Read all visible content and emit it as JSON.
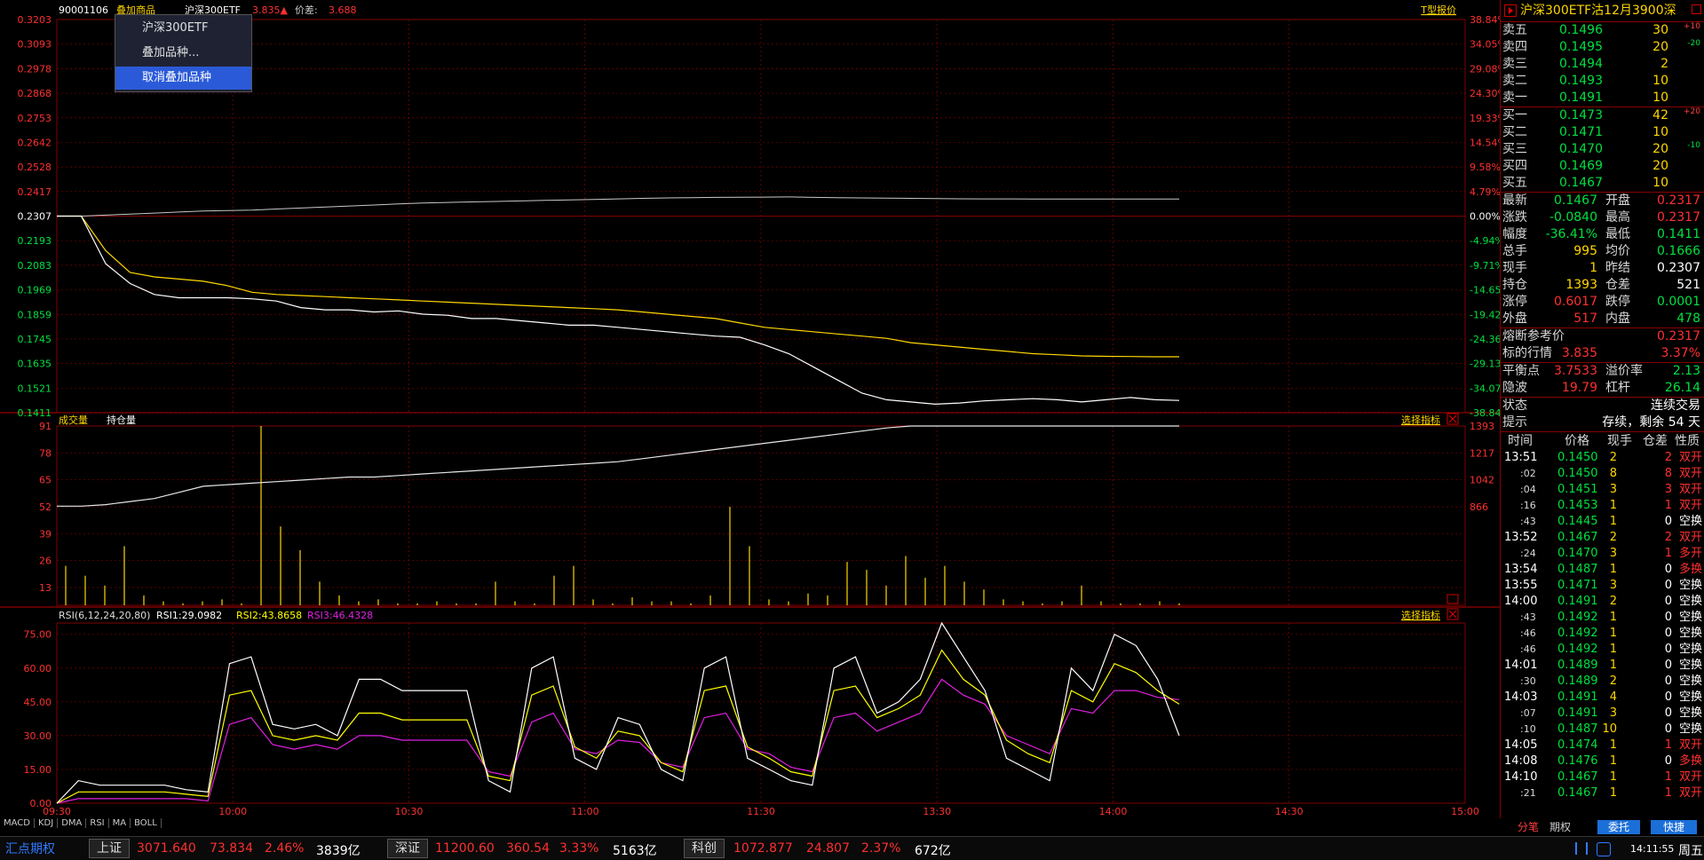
{
  "header": {
    "code": "90001106",
    "overlay_menu": "叠加商品",
    "overlay_name": "沪深300ETF",
    "overlay_price": "3.835▲",
    "spread_label": "价差:",
    "spread_value": "3.688",
    "t_quote": "T型报价"
  },
  "overlay_dropdown": {
    "items": [
      "沪深300ETF",
      "叠加品种...",
      "取消叠加品种"
    ]
  },
  "price_axis": {
    "left": [
      "0.3203",
      "0.3093",
      "0.2978",
      "0.2868",
      "0.2753",
      "0.2642",
      "0.2528",
      "0.2417",
      "0.2307",
      "0.2193",
      "0.2083",
      "0.1969",
      "0.1859",
      "0.1745",
      "0.1635",
      "0.1521",
      "0.1411"
    ],
    "right": [
      "38.84%",
      "34.05%",
      "29.08%",
      "24.30%",
      "19.33%",
      "14.54%",
      "9.58%",
      "4.79%",
      "0.00%",
      "-4.94%",
      "-9.71%",
      "-14.65%",
      "-19.42%",
      "-24.36%",
      "-29.13%",
      "-34.07%",
      "-38.84%"
    ]
  },
  "volume_panel": {
    "tab_volume": "成交量",
    "tab_oi": "持仓量",
    "select_indicator": "选择指标",
    "left_axis": [
      "91",
      "78",
      "65",
      "52",
      "39",
      "26",
      "13"
    ],
    "right_axis": [
      "1393",
      "1217",
      "1042",
      "866"
    ]
  },
  "rsi_panel": {
    "title": "RSI(6,12,24,20,80)",
    "rsi1": "RSI1:29.0982",
    "rsi2": "RSI2:43.8658",
    "rsi3": "RSI3:46.4328",
    "select_indicator": "选择指标",
    "axis": [
      "75.00",
      "60.00",
      "45.00",
      "30.00",
      "15.00",
      "0.00"
    ]
  },
  "time_axis": [
    "09:30",
    "10:00",
    "10:30",
    "11:00",
    "11:30",
    "13:30",
    "14:00",
    "14:30",
    "15:00"
  ],
  "indicator_tabs": [
    "MACD",
    "KDJ",
    "DMA",
    "RSI",
    "MA",
    "BOLL"
  ],
  "panel": {
    "title": "沪深300ETF沽12月3900深",
    "asks": [
      {
        "label": "卖五",
        "price": "0.1496",
        "vol": "30",
        "chg": "+10"
      },
      {
        "label": "卖四",
        "price": "0.1495",
        "vol": "20",
        "chg": "-20"
      },
      {
        "label": "卖三",
        "price": "0.1494",
        "vol": "2",
        "chg": ""
      },
      {
        "label": "卖二",
        "price": "0.1493",
        "vol": "10",
        "chg": ""
      },
      {
        "label": "卖一",
        "price": "0.1491",
        "vol": "10",
        "chg": ""
      }
    ],
    "bids": [
      {
        "label": "买一",
        "price": "0.1473",
        "vol": "42",
        "chg": "+20"
      },
      {
        "label": "买二",
        "price": "0.1471",
        "vol": "10",
        "chg": ""
      },
      {
        "label": "买三",
        "price": "0.1470",
        "vol": "20",
        "chg": "-10"
      },
      {
        "label": "买四",
        "price": "0.1469",
        "vol": "20",
        "chg": ""
      },
      {
        "label": "买五",
        "price": "0.1467",
        "vol": "10",
        "chg": ""
      }
    ],
    "quotes": [
      {
        "l1": "最新",
        "v1": "0.1467",
        "c1": "grn",
        "l2": "开盘",
        "v2": "0.2317",
        "c2": "red"
      },
      {
        "l1": "涨跌",
        "v1": "-0.0840",
        "c1": "grn",
        "l2": "最高",
        "v2": "0.2317",
        "c2": "red"
      },
      {
        "l1": "幅度",
        "v1": "-36.41%",
        "c1": "grn",
        "l2": "最低",
        "v2": "0.1411",
        "c2": "grn"
      },
      {
        "l1": "总手",
        "v1": "995",
        "c1": "yel",
        "l2": "均价",
        "v2": "0.1666",
        "c2": "grn"
      },
      {
        "l1": "现手",
        "v1": "1",
        "c1": "yel",
        "l2": "昨结",
        "v2": "0.2307",
        "c2": "wht"
      },
      {
        "l1": "持仓",
        "v1": "1393",
        "c1": "yel",
        "l2": "仓差",
        "v2": "521",
        "c2": "wht"
      },
      {
        "l1": "涨停",
        "v1": "0.6017",
        "c1": "red",
        "l2": "跌停",
        "v2": "0.0001",
        "c2": "grn"
      },
      {
        "l1": "外盘",
        "v1": "517",
        "c1": "red",
        "l2": "内盘",
        "v2": "478",
        "c2": "grn"
      }
    ],
    "fuse_label": "熔断参考价",
    "fuse_value": "0.2317",
    "underlying_label": "标的行情",
    "underlying_price": "3.835",
    "underlying_pct": "3.37%",
    "balance_label": "平衡点",
    "balance_value": "3.7533",
    "premium_label": "溢价率",
    "premium_value": "2.13",
    "iv_label": "隐波",
    "iv_value": "19.79",
    "leverage_label": "杠杆",
    "leverage_value": "26.14",
    "state_label": "状态",
    "state_value": "连续交易",
    "hint_label": "提示",
    "hint_value": "存续，剩余",
    "hint_days": "54",
    "hint_unit": "天",
    "tick_headers": [
      "时间",
      "价格",
      "现手",
      "仓差",
      "性质"
    ],
    "ticks": [
      {
        "t": "13:51",
        "p": "0.1450",
        "v": "2",
        "c": "2",
        "n": "双开",
        "pc": "grn",
        "cc": "red",
        "nc": "red"
      },
      {
        "t": ":02",
        "p": "0.1450",
        "v": "8",
        "c": "8",
        "n": "双开",
        "pc": "grn",
        "cc": "red",
        "nc": "red"
      },
      {
        "t": ":04",
        "p": "0.1451",
        "v": "3",
        "c": "3",
        "n": "双开",
        "pc": "grn",
        "cc": "red",
        "nc": "red"
      },
      {
        "t": ":16",
        "p": "0.1453",
        "v": "1",
        "c": "1",
        "n": "双开",
        "pc": "grn",
        "cc": "red",
        "nc": "red"
      },
      {
        "t": ":43",
        "p": "0.1445",
        "v": "1",
        "c": "0",
        "n": "空换",
        "pc": "grn",
        "cc": "wht",
        "nc": "wht"
      },
      {
        "t": "13:52",
        "p": "0.1467",
        "v": "2",
        "c": "2",
        "n": "双开",
        "pc": "grn",
        "cc": "red",
        "nc": "red"
      },
      {
        "t": ":24",
        "p": "0.1470",
        "v": "3",
        "c": "1",
        "n": "多开",
        "pc": "grn",
        "cc": "red",
        "nc": "red"
      },
      {
        "t": "13:54",
        "p": "0.1487",
        "v": "1",
        "c": "0",
        "n": "多换",
        "pc": "grn",
        "cc": "wht",
        "nc": "red"
      },
      {
        "t": "13:55",
        "p": "0.1471",
        "v": "3",
        "c": "0",
        "n": "空换",
        "pc": "grn",
        "cc": "wht",
        "nc": "wht"
      },
      {
        "t": "14:00",
        "p": "0.1491",
        "v": "2",
        "c": "0",
        "n": "空换",
        "pc": "grn",
        "cc": "wht",
        "nc": "wht"
      },
      {
        "t": ":43",
        "p": "0.1492",
        "v": "1",
        "c": "0",
        "n": "空换",
        "pc": "grn",
        "cc": "wht",
        "nc": "wht"
      },
      {
        "t": ":46",
        "p": "0.1492",
        "v": "1",
        "c": "0",
        "n": "空换",
        "pc": "grn",
        "cc": "wht",
        "nc": "wht"
      },
      {
        "t": ":46",
        "p": "0.1492",
        "v": "1",
        "c": "0",
        "n": "空换",
        "pc": "grn",
        "cc": "wht",
        "nc": "wht"
      },
      {
        "t": "14:01",
        "p": "0.1489",
        "v": "1",
        "c": "0",
        "n": "空换",
        "pc": "grn",
        "cc": "wht",
        "nc": "wht"
      },
      {
        "t": ":30",
        "p": "0.1489",
        "v": "2",
        "c": "0",
        "n": "空换",
        "pc": "grn",
        "cc": "wht",
        "nc": "wht"
      },
      {
        "t": "14:03",
        "p": "0.1491",
        "v": "4",
        "c": "0",
        "n": "空换",
        "pc": "grn",
        "cc": "wht",
        "nc": "wht"
      },
      {
        "t": ":07",
        "p": "0.1491",
        "v": "3",
        "c": "0",
        "n": "空换",
        "pc": "grn",
        "cc": "wht",
        "nc": "wht"
      },
      {
        "t": ":10",
        "p": "0.1487",
        "v": "10",
        "c": "0",
        "n": "空换",
        "pc": "grn",
        "cc": "wht",
        "nc": "wht"
      },
      {
        "t": "14:05",
        "p": "0.1474",
        "v": "1",
        "c": "1",
        "n": "双开",
        "pc": "grn",
        "cc": "red",
        "nc": "red"
      },
      {
        "t": "14:08",
        "p": "0.1476",
        "v": "1",
        "c": "0",
        "n": "多换",
        "pc": "grn",
        "cc": "wht",
        "nc": "red"
      },
      {
        "t": "14:10",
        "p": "0.1467",
        "v": "1",
        "c": "1",
        "n": "双开",
        "pc": "grn",
        "cc": "red",
        "nc": "red"
      },
      {
        "t": ":21",
        "p": "0.1467",
        "v": "1",
        "c": "1",
        "n": "双开",
        "pc": "grn",
        "cc": "red",
        "nc": "red"
      }
    ],
    "bottom_tabs": [
      "分笔",
      "期权",
      "委托",
      "快捷"
    ]
  },
  "status_bar": {
    "logo": "汇点期权",
    "sh_label": "上证",
    "sh_index": "3071.640",
    "sh_chg": "73.834",
    "sh_pct": "2.46%",
    "sh_amt": "3839亿",
    "sz_label": "深证",
    "sz_index": "11200.60",
    "sz_chg": "360.54",
    "sz_pct": "3.33%",
    "sz_amt": "5163亿",
    "kc_label": "科创",
    "kc_index": "1072.877",
    "kc_chg": "24.807",
    "kc_pct": "2.37%",
    "kc_amt": "672亿",
    "time": "14:11:55",
    "weekday": "周五"
  },
  "colors": {
    "grid": "#800000",
    "up": "#ff3030",
    "down": "#00e040",
    "price_line": "#ffffff",
    "avg_line": "#ffd700",
    "rsi2": "#ffff00",
    "rsi3": "#e020e0"
  },
  "chart_data": {
    "type": "line",
    "price": [
      0.2307,
      0.2307,
      0.209,
      0.2,
      0.195,
      0.1935,
      0.1935,
      0.1935,
      0.193,
      0.192,
      0.189,
      0.188,
      0.188,
      0.187,
      0.1875,
      0.186,
      0.1855,
      0.184,
      0.184,
      0.183,
      0.182,
      0.181,
      0.181,
      0.18,
      0.179,
      0.178,
      0.177,
      0.176,
      0.1755,
      0.172,
      0.168,
      0.162,
      0.156,
      0.15,
      0.147,
      0.146,
      0.145,
      0.1455,
      0.1465,
      0.147,
      0.1475,
      0.147,
      0.146,
      0.147,
      0.148,
      0.147,
      0.1467
    ],
    "avg": [
      0.2307,
      0.2307,
      0.215,
      0.205,
      0.203,
      0.202,
      0.201,
      0.199,
      0.196,
      0.195,
      0.1945,
      0.194,
      0.1935,
      0.193,
      0.1925,
      0.192,
      0.1915,
      0.191,
      0.1905,
      0.19,
      0.1895,
      0.189,
      0.1885,
      0.188,
      0.187,
      0.186,
      0.185,
      0.184,
      0.182,
      0.18,
      0.179,
      0.178,
      0.177,
      0.176,
      0.175,
      0.173,
      0.172,
      0.171,
      0.17,
      0.169,
      0.168,
      0.1675,
      0.167,
      0.1668,
      0.1667,
      0.1666,
      0.1666
    ],
    "underlying_pct": [
      0.0,
      0.0,
      0.2,
      0.4,
      0.6,
      0.8,
      1.0,
      1.1,
      1.2,
      1.4,
      1.6,
      1.8,
      2.0,
      2.2,
      2.4,
      2.6,
      2.7,
      2.8,
      2.9,
      3.0,
      3.1,
      3.2,
      3.3,
      3.4,
      3.5,
      3.6,
      3.65,
      3.7,
      3.72,
      3.75,
      3.78,
      3.7,
      3.65,
      3.6,
      3.55,
      3.5,
      3.45,
      3.42,
      3.4,
      3.4,
      3.38,
      3.38,
      3.37,
      3.38,
      3.38,
      3.37,
      3.37
    ],
    "oi": [
      870,
      870,
      880,
      900,
      920,
      960,
      1000,
      1010,
      1020,
      1030,
      1040,
      1050,
      1060,
      1060,
      1070,
      1080,
      1090,
      1100,
      1110,
      1120,
      1130,
      1140,
      1150,
      1160,
      1180,
      1200,
      1220,
      1240,
      1260,
      1280,
      1300,
      1320,
      1340,
      1360,
      1380,
      1393,
      1393,
      1393,
      1393,
      1393,
      1393,
      1393,
      1393,
      1393,
      1393,
      1393,
      1393
    ],
    "volume": [
      20,
      15,
      10,
      30,
      5,
      2,
      1,
      2,
      3,
      1,
      91,
      40,
      28,
      12,
      5,
      2,
      3,
      1,
      1,
      2,
      1,
      1,
      12,
      2,
      1,
      15,
      20,
      3,
      1,
      4,
      2,
      2,
      1,
      5,
      50,
      30,
      3,
      2,
      6,
      5,
      22,
      18,
      10,
      25,
      14,
      20,
      12,
      8,
      3,
      2,
      1,
      2,
      10,
      2,
      1,
      1,
      2,
      1
    ],
    "rsi1": [
      0,
      10,
      8,
      8,
      8,
      8,
      6,
      5,
      62,
      65,
      35,
      33,
      35,
      30,
      55,
      55,
      50,
      50,
      50,
      50,
      10,
      5,
      60,
      65,
      20,
      15,
      38,
      35,
      15,
      10,
      60,
      65,
      20,
      15,
      10,
      8,
      60,
      65,
      40,
      45,
      55,
      80,
      65,
      50,
      20,
      15,
      10,
      60,
      50,
      75,
      70,
      55,
      30
    ],
    "rsi2": [
      0,
      5,
      5,
      5,
      5,
      5,
      4,
      3,
      48,
      50,
      30,
      28,
      30,
      28,
      40,
      40,
      37,
      37,
      37,
      37,
      12,
      10,
      48,
      52,
      25,
      20,
      32,
      30,
      18,
      14,
      50,
      52,
      25,
      20,
      14,
      12,
      50,
      52,
      38,
      42,
      48,
      68,
      55,
      48,
      28,
      22,
      18,
      50,
      45,
      62,
      58,
      50,
      44
    ],
    "rsi3": [
      0,
      2,
      2,
      2,
      2,
      2,
      2,
      1,
      35,
      38,
      26,
      24,
      26,
      24,
      30,
      30,
      28,
      28,
      28,
      28,
      14,
      12,
      36,
      40,
      24,
      22,
      28,
      27,
      18,
      16,
      38,
      40,
      24,
      22,
      16,
      14,
      38,
      40,
      32,
      36,
      40,
      55,
      48,
      44,
      30,
      26,
      22,
      42,
      40,
      50,
      50,
      47,
      46
    ],
    "ylim_price": [
      0.1411,
      0.3203
    ],
    "ylim_rsi": [
      0,
      80
    ],
    "ylim_volume": [
      0,
      91
    ],
    "ylim_oi": [
      866,
      1393
    ]
  }
}
